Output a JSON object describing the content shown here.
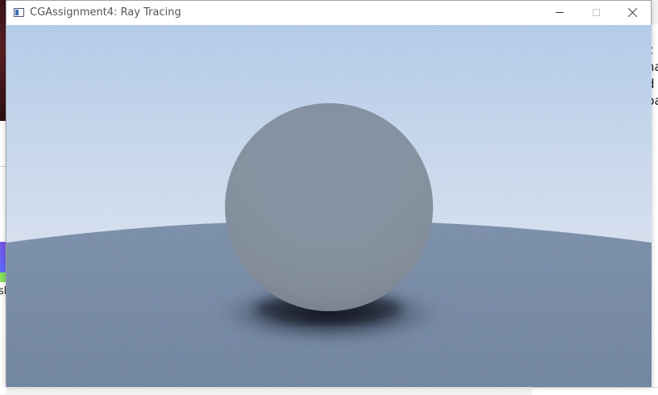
{
  "window": {
    "title": "CGAssignment4: Ray Tracing",
    "controls": [
      "minimize",
      "maximize",
      "close"
    ]
  },
  "background": {
    "left_fragment_text": "sk",
    "right_fragment_text": [
      "c",
      "na",
      "d",
      "pa"
    ]
  },
  "render": {
    "sky_top_color": "#bfd7f6",
    "sky_horizon_color": "#eef4fd",
    "ground_color": "#8195b2",
    "sphere_color": "#8a97a8"
  }
}
